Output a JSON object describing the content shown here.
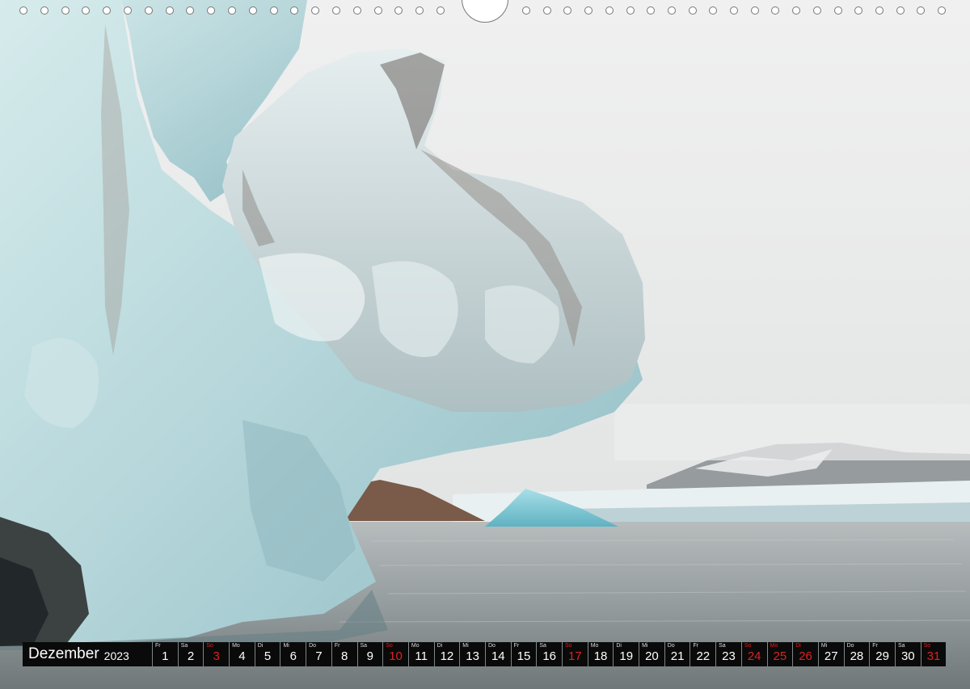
{
  "calendar": {
    "month": "Dezember",
    "year": "2023",
    "days": [
      {
        "wd": "Fr",
        "n": "1",
        "red": false
      },
      {
        "wd": "Sa",
        "n": "2",
        "red": false
      },
      {
        "wd": "So",
        "n": "3",
        "red": true
      },
      {
        "wd": "Mo",
        "n": "4",
        "red": false
      },
      {
        "wd": "Di",
        "n": "5",
        "red": false
      },
      {
        "wd": "Mi",
        "n": "6",
        "red": false
      },
      {
        "wd": "Do",
        "n": "7",
        "red": false
      },
      {
        "wd": "Fr",
        "n": "8",
        "red": false
      },
      {
        "wd": "Sa",
        "n": "9",
        "red": false
      },
      {
        "wd": "So",
        "n": "10",
        "red": true
      },
      {
        "wd": "Mo",
        "n": "11",
        "red": false
      },
      {
        "wd": "Di",
        "n": "12",
        "red": false
      },
      {
        "wd": "Mi",
        "n": "13",
        "red": false
      },
      {
        "wd": "Do",
        "n": "14",
        "red": false
      },
      {
        "wd": "Fr",
        "n": "15",
        "red": false
      },
      {
        "wd": "Sa",
        "n": "16",
        "red": false
      },
      {
        "wd": "So",
        "n": "17",
        "red": true
      },
      {
        "wd": "Mo",
        "n": "18",
        "red": false
      },
      {
        "wd": "Di",
        "n": "19",
        "red": false
      },
      {
        "wd": "Mi",
        "n": "20",
        "red": false
      },
      {
        "wd": "Do",
        "n": "21",
        "red": false
      },
      {
        "wd": "Fr",
        "n": "22",
        "red": false
      },
      {
        "wd": "Sa",
        "n": "23",
        "red": false
      },
      {
        "wd": "So",
        "n": "24",
        "red": true
      },
      {
        "wd": "Mo",
        "n": "25",
        "red": true
      },
      {
        "wd": "Di",
        "n": "26",
        "red": true
      },
      {
        "wd": "Mi",
        "n": "27",
        "red": false
      },
      {
        "wd": "Do",
        "n": "28",
        "red": false
      },
      {
        "wd": "Fr",
        "n": "29",
        "red": false
      },
      {
        "wd": "Sa",
        "n": "30",
        "red": false
      },
      {
        "wd": "So",
        "n": "31",
        "red": true
      }
    ]
  },
  "colors": {
    "holiday": "#e02020",
    "cell": "#0a0a0a",
    "sky": "#ededed",
    "water": "#8a9295",
    "ice": "#bfdde0"
  }
}
